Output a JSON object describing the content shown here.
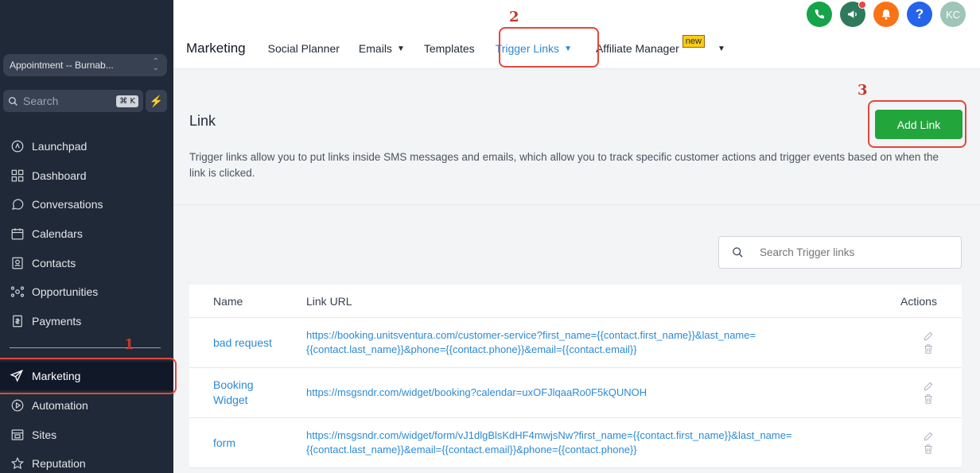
{
  "sidebar": {
    "account": "Appointment -- Burnab...",
    "search_placeholder": "Search",
    "search_shortcut": "⌘ K",
    "items": [
      {
        "label": "Launchpad",
        "icon": "launchpad-icon"
      },
      {
        "label": "Dashboard",
        "icon": "dashboard-icon"
      },
      {
        "label": "Conversations",
        "icon": "chat-icon"
      },
      {
        "label": "Calendars",
        "icon": "calendar-icon"
      },
      {
        "label": "Contacts",
        "icon": "contacts-icon"
      },
      {
        "label": "Opportunities",
        "icon": "opportunities-icon"
      },
      {
        "label": "Payments",
        "icon": "payments-icon"
      }
    ],
    "active": {
      "label": "Marketing",
      "icon": "send-icon"
    },
    "items_after": [
      {
        "label": "Automation",
        "icon": "automation-icon"
      },
      {
        "label": "Sites",
        "icon": "sites-icon"
      },
      {
        "label": "Reputation",
        "icon": "star-icon"
      }
    ]
  },
  "header": {
    "title": "Marketing",
    "menu": [
      "Social Planner",
      "Emails",
      "Templates",
      "Trigger Links",
      "Affiliate Manager"
    ],
    "new_badge": "new",
    "avatar": "KC",
    "icon_colors": {
      "phone": "#16a34a",
      "megaphone": "#2f7a5c",
      "bell": "#f97316",
      "help": "#2563eb",
      "avatar": "#9fc4b8"
    }
  },
  "annotations": {
    "one": "1",
    "two": "2",
    "three": "3"
  },
  "main": {
    "title": "Link",
    "add_button": "Add Link",
    "description": "Trigger links allow you to put links inside SMS messages and emails, which allow you to track specific customer actions and trigger events based on when the link is clicked.",
    "search_placeholder": "Search Trigger links",
    "table": {
      "headers": [
        "Name",
        "Link URL",
        "Actions"
      ],
      "rows": [
        {
          "name": "bad request",
          "url": "https://booking.unitsventura.com/customer-service?first_name={{contact.first_name}}&last_name={{contact.last_name}}&phone={{contact.phone}}&email={{contact.email}}"
        },
        {
          "name": "Booking Widget",
          "url": "https://msgsndr.com/widget/booking?calendar=uxOFJlqaaRo0F5kQUNOH"
        },
        {
          "name": "form",
          "url": "https://msgsndr.com/widget/form/vJ1dlgBlsKdHF4mwjsNw?first_name={{contact.first_name}}&last_name={{contact.last_name}}&email={{contact.email}}&phone={{contact.phone}}"
        }
      ]
    }
  }
}
